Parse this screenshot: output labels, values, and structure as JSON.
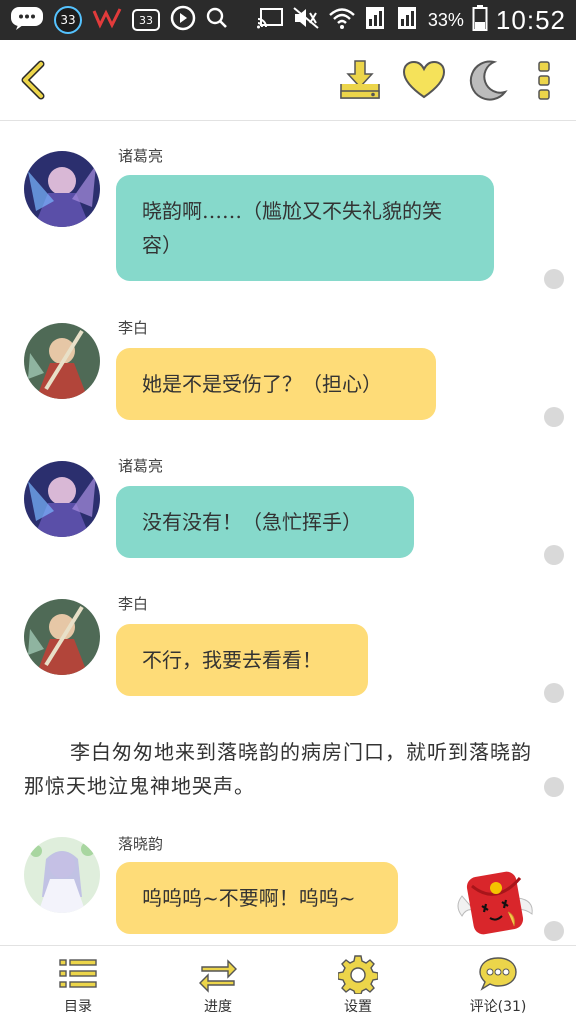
{
  "status_bar": {
    "notif_count_a": "33",
    "notif_count_b": "33",
    "battery": "33%",
    "time": "10:52"
  },
  "chat": {
    "messages": [
      {
        "speaker": "诸葛亮",
        "text": "晓韵啊……（尴尬又不失礼貌的笑容）",
        "color": "#86d9cb"
      },
      {
        "speaker": "李白",
        "text": "她是不是受伤了？（担心）",
        "color": "#fedc78"
      },
      {
        "speaker": "诸葛亮",
        "text": "没有没有！（急忙挥手）",
        "color": "#86d9cb"
      },
      {
        "speaker": "李白",
        "text": "不行，我要去看看！",
        "color": "#fedc78"
      },
      {
        "speaker": "落晓韵",
        "text": "呜呜呜~不要啊！呜呜~",
        "color": "#fedc78"
      }
    ],
    "narration": "李白匆匆地来到落晓韵的病房门口，就听到落晓韵那惊天地泣鬼神地哭声。"
  },
  "bottom_nav": {
    "items": [
      {
        "label": "目录",
        "icon": "list-icon"
      },
      {
        "label": "进度",
        "icon": "swap-arrows-icon"
      },
      {
        "label": "设置",
        "icon": "gear-icon"
      },
      {
        "label": "评论(31)",
        "icon": "comment-icon"
      }
    ]
  },
  "colors": {
    "accent": "#ecd54a",
    "teal_bubble": "#86d9cb",
    "yellow_bubble": "#fedc78"
  }
}
